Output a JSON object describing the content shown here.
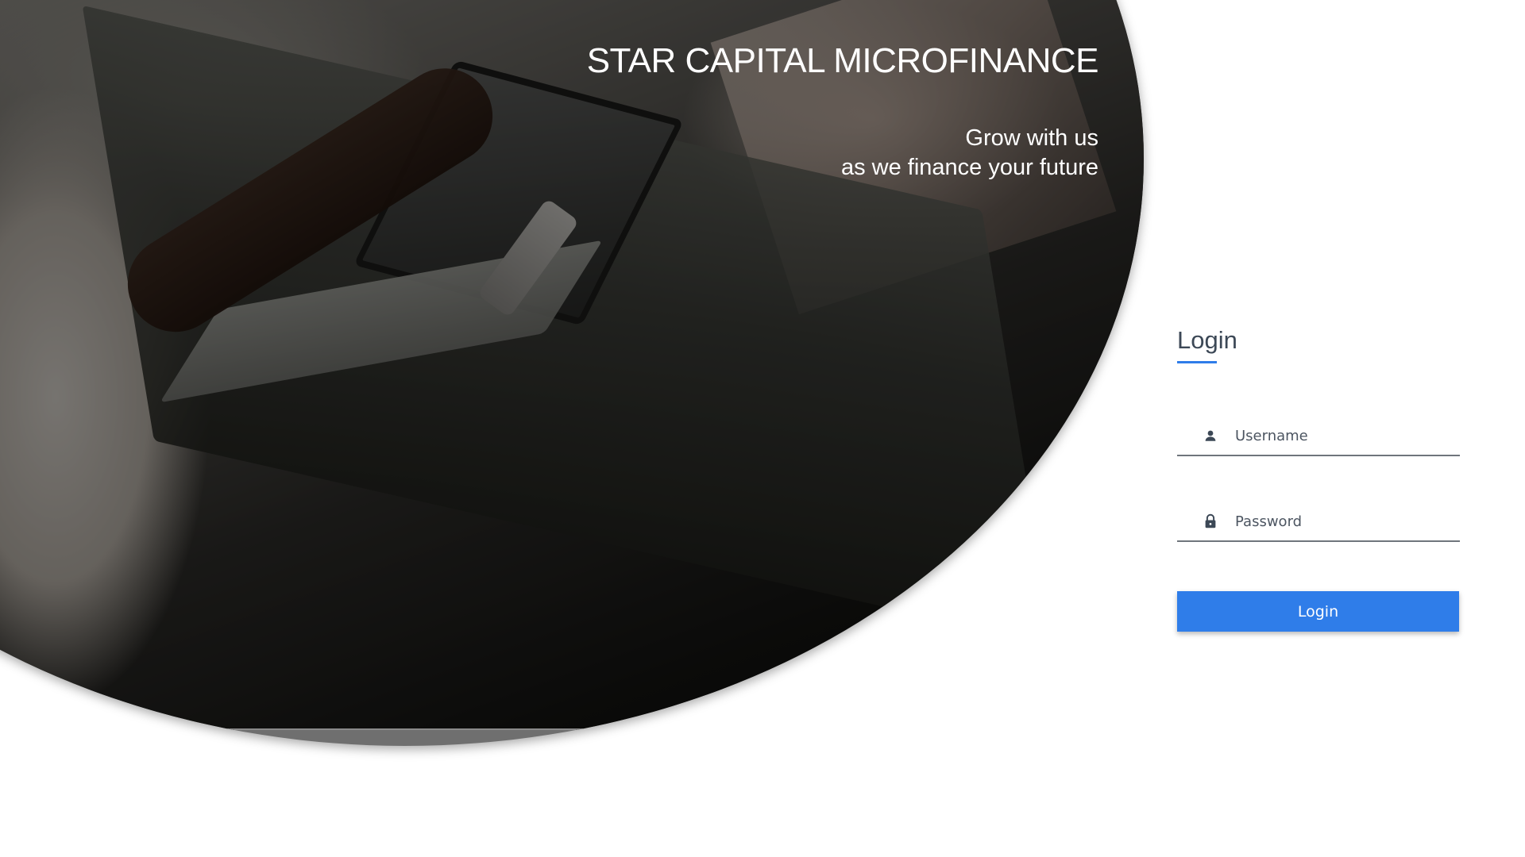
{
  "hero": {
    "title": "STAR CAPITAL MICROFINANCE",
    "tagline_line1": "Grow with us",
    "tagline_line2": "as we finance your future"
  },
  "login": {
    "heading": "Login",
    "username_placeholder": "Username",
    "username_value": "",
    "password_placeholder": "Password",
    "password_value": "",
    "submit_label": "Login",
    "username_icon": "person-icon",
    "password_icon": "lock-icon"
  },
  "colors": {
    "accent": "#2f7de9",
    "heading_text": "#3c4856",
    "field_underline": "#6f757c",
    "background": "#ffffff"
  }
}
